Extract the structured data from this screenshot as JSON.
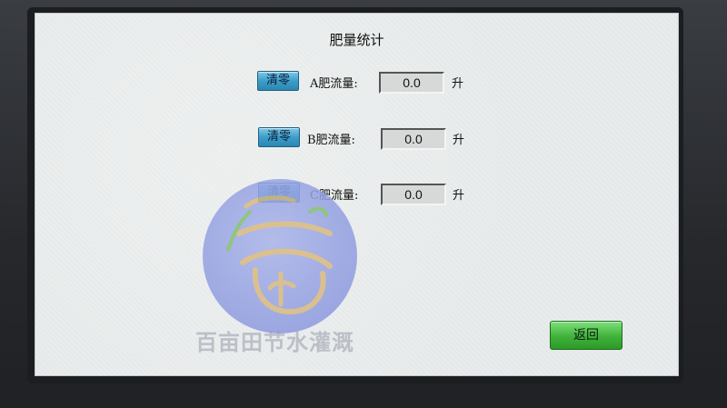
{
  "screen": {
    "title": "肥量统计",
    "watermark": "百亩田节水灌溉"
  },
  "rows": [
    {
      "clear_label": "清零",
      "label": "A肥流量:",
      "value": "0.0",
      "unit": "升"
    },
    {
      "clear_label": "清零",
      "label": "B肥流量:",
      "value": "0.0",
      "unit": "升"
    },
    {
      "clear_label": "清零",
      "label": "C肥流量:",
      "value": "0.0",
      "unit": "升"
    }
  ],
  "back_label": "返回",
  "colors": {
    "clear_button": "#3c9ec9",
    "back_button": "#3fb23b",
    "screen_bg": "#e9ecec",
    "logo": "#8f9ce0"
  },
  "icons": {
    "logo": "brand-logo-icon"
  }
}
